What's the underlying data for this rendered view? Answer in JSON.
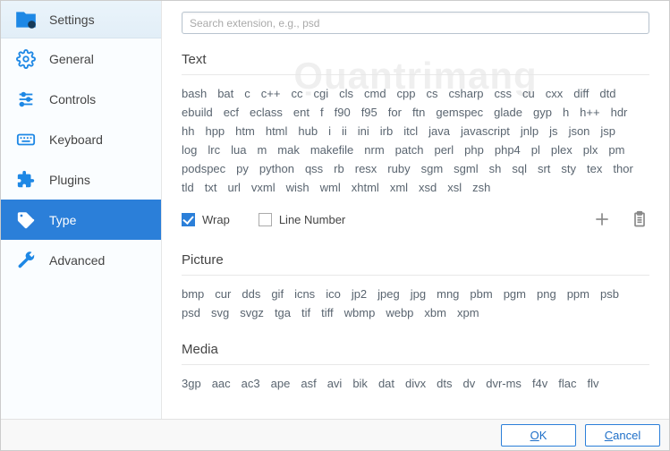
{
  "header": {
    "title": "Settings"
  },
  "sidebar": {
    "items": [
      {
        "label": "General"
      },
      {
        "label": "Controls"
      },
      {
        "label": "Keyboard"
      },
      {
        "label": "Plugins"
      },
      {
        "label": "Type"
      },
      {
        "label": "Advanced"
      }
    ]
  },
  "search": {
    "placeholder": "Search extension, e.g., psd"
  },
  "sections": {
    "text": {
      "title": "Text",
      "tags": [
        "bash",
        "bat",
        "c",
        "c++",
        "cc",
        "cgi",
        "cls",
        "cmd",
        "cpp",
        "cs",
        "csharp",
        "css",
        "cu",
        "cxx",
        "diff",
        "dtd",
        "ebuild",
        "ecf",
        "eclass",
        "ent",
        "f",
        "f90",
        "f95",
        "for",
        "ftn",
        "gemspec",
        "glade",
        "gyp",
        "h",
        "h++",
        "hdr",
        "hh",
        "hpp",
        "htm",
        "html",
        "hub",
        "i",
        "ii",
        "ini",
        "irb",
        "itcl",
        "java",
        "javascript",
        "jnlp",
        "js",
        "json",
        "jsp",
        "log",
        "lrc",
        "lua",
        "m",
        "mak",
        "makefile",
        "nrm",
        "patch",
        "perl",
        "php",
        "php4",
        "pl",
        "plex",
        "plx",
        "pm",
        "podspec",
        "py",
        "python",
        "qss",
        "rb",
        "resx",
        "ruby",
        "sgm",
        "sgml",
        "sh",
        "sql",
        "srt",
        "sty",
        "tex",
        "thor",
        "tld",
        "txt",
        "url",
        "vxml",
        "wish",
        "wml",
        "xhtml",
        "xml",
        "xsd",
        "xsl",
        "zsh"
      ]
    },
    "picture": {
      "title": "Picture",
      "tags": [
        "bmp",
        "cur",
        "dds",
        "gif",
        "icns",
        "ico",
        "jp2",
        "jpeg",
        "jpg",
        "mng",
        "pbm",
        "pgm",
        "png",
        "ppm",
        "psb",
        "psd",
        "svg",
        "svgz",
        "tga",
        "tif",
        "tiff",
        "wbmp",
        "webp",
        "xbm",
        "xpm"
      ]
    },
    "media": {
      "title": "Media",
      "tags": [
        "3gp",
        "aac",
        "ac3",
        "ape",
        "asf",
        "avi",
        "bik",
        "dat",
        "divx",
        "dts",
        "dv",
        "dvr-ms",
        "f4v",
        "flac",
        "flv"
      ]
    }
  },
  "options": {
    "wrap": "Wrap",
    "line_number": "Line Number"
  },
  "buttons": {
    "ok": "OK",
    "ok_ul": "O",
    "ok_rest": "K",
    "cancel": "Cancel",
    "cancel_ul": "C",
    "cancel_rest": "ancel"
  },
  "watermark": "Ọuantrimang"
}
